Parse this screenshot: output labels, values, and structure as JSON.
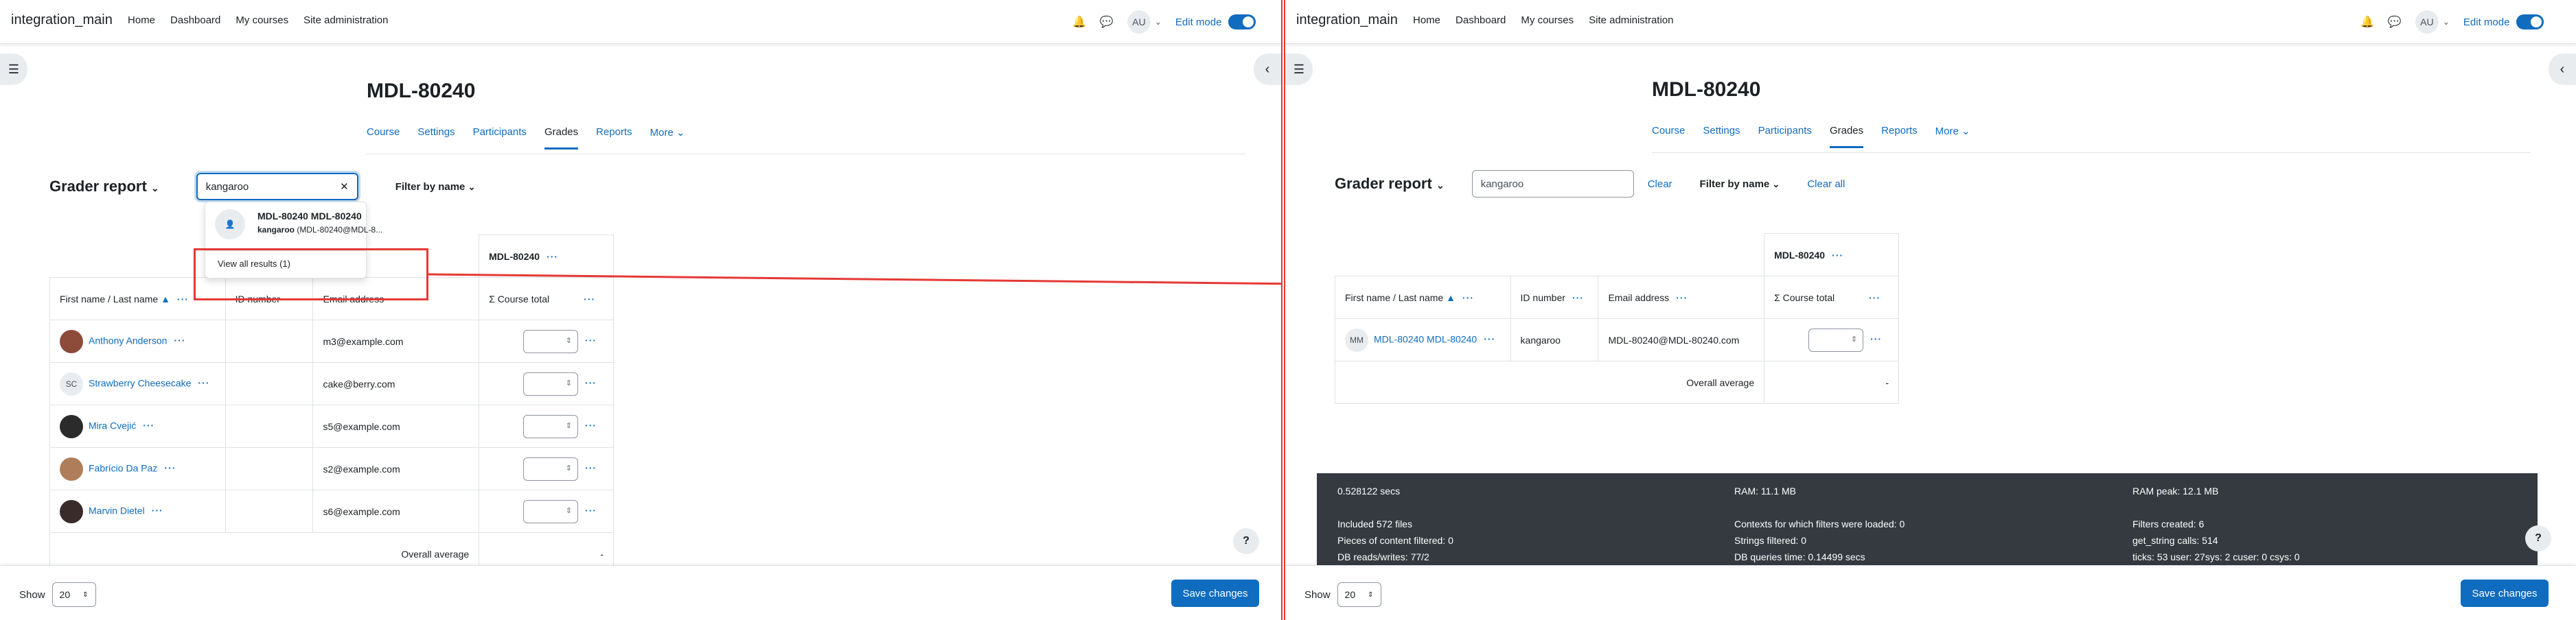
{
  "site": {
    "brand": "integration_main",
    "nav": [
      "Home",
      "Dashboard",
      "My courses",
      "Site administration"
    ],
    "avatar": "AU",
    "edit_mode": "Edit mode"
  },
  "course": {
    "title": "MDL-80240",
    "tabs": [
      "Course",
      "Settings",
      "Participants",
      "Grades",
      "Reports",
      "More"
    ]
  },
  "left": {
    "grader_report": "Grader report",
    "search_value": "kangaroo",
    "filter_by_name": "Filter by name",
    "dropdown": {
      "result_name": "MDL-80240 MDL-80240",
      "result_match_bold": "kangaroo",
      "result_match_rest": " (MDL-80240@MDL-8...",
      "view_all": "View all results (1)"
    },
    "headers": {
      "course": "MDL-80240",
      "name": "First name / Last name",
      "id": "ID number",
      "email": "Email address",
      "total": "Course total"
    },
    "rows": [
      {
        "name": "Anthony Anderson",
        "initials": "",
        "email": "m3@example.com",
        "color": "#8d4b3a"
      },
      {
        "name": "Strawberry Cheesecake",
        "initials": "SC",
        "email": "cake@berry.com",
        "color": "#e9ecef"
      },
      {
        "name": "Mira Cvejić",
        "initials": "",
        "email": "s5@example.com",
        "color": "#2b2b2b"
      },
      {
        "name": "Fabrício Da Paz",
        "initials": "",
        "email": "s2@example.com",
        "color": "#b07d5b"
      },
      {
        "name": "Marvin Dietel",
        "initials": "",
        "email": "s6@example.com",
        "color": "#3a2b2b"
      }
    ],
    "overall_average": "Overall average",
    "overall_value": "-"
  },
  "right": {
    "grader_report": "Grader report",
    "search_value": "kangaroo",
    "clear": "Clear",
    "filter_by_name": "Filter by name",
    "clear_all": "Clear all",
    "headers": {
      "course": "MDL-80240",
      "name": "First name / Last name",
      "id": "ID number",
      "email": "Email address",
      "total": "Course total"
    },
    "row": {
      "initials": "MM",
      "name": "MDL-80240 MDL-80240",
      "id": "kangaroo",
      "email": "MDL-80240@MDL-80240.com"
    },
    "overall_average": "Overall average",
    "overall_value": "-",
    "perf": {
      "c1": [
        "0.528122 secs",
        "",
        "Included 572 files",
        "Pieces of content filtered: 0",
        "DB reads/writes: 77/2"
      ],
      "c2": [
        "RAM: 11.1 MB",
        "",
        "Contexts for which filters were loaded: 0",
        "Strings filtered: 0",
        "DB queries time: 0.14499 secs"
      ],
      "c3": [
        "RAM peak: 12.1 MB",
        "",
        "Filters created: 6",
        "get_string calls: 514",
        "ticks: 53 user: 27sys: 2 cuser: 0 csys: 0"
      ]
    }
  },
  "footer": {
    "show": "Show",
    "show_value": "20",
    "save": "Save changes"
  },
  "colors": {
    "accent": "#0f6cbf",
    "annotation": "#e53935"
  }
}
